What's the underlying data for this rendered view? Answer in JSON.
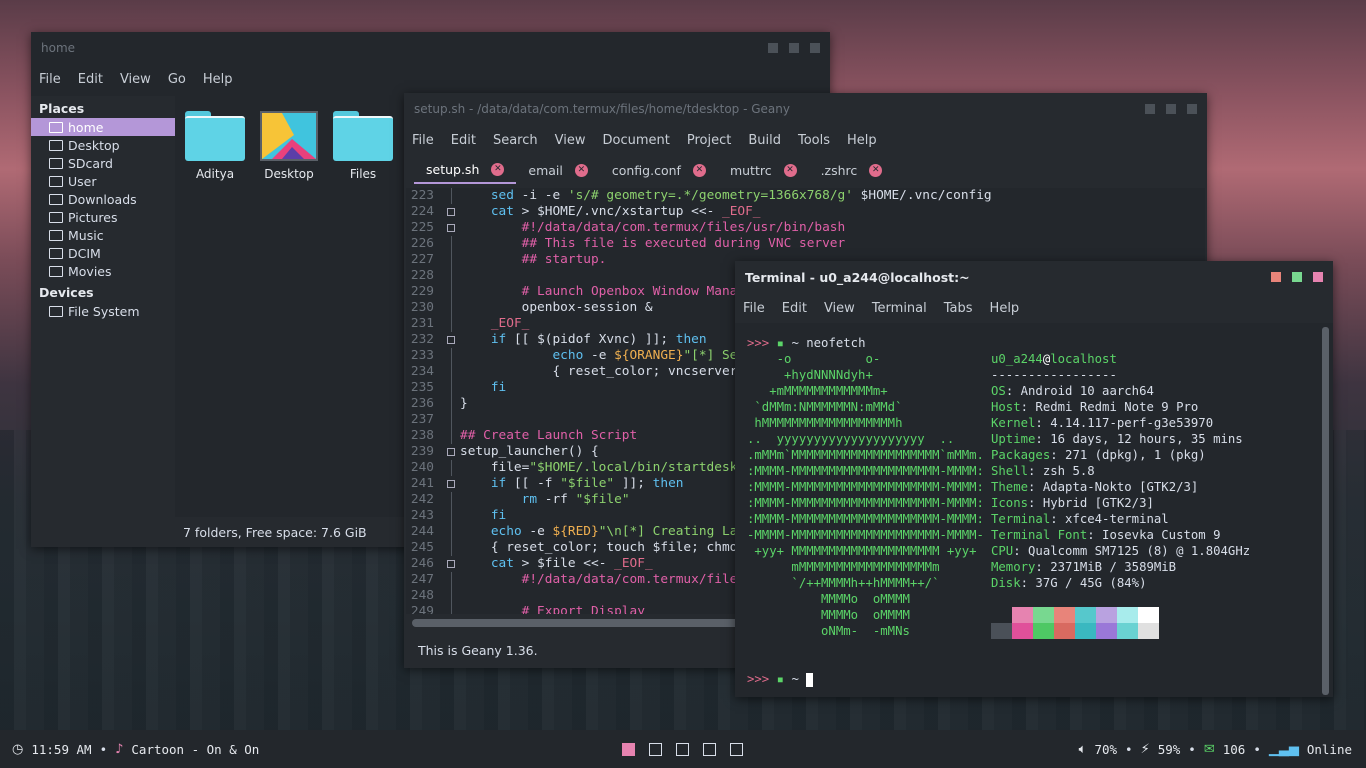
{
  "file_manager": {
    "title": "home",
    "menu": [
      "File",
      "Edit",
      "View",
      "Go",
      "Help"
    ],
    "places_header": "Places",
    "places": [
      "home",
      "Desktop",
      "SDcard",
      "User",
      "Downloads",
      "Pictures",
      "Music",
      "DCIM",
      "Movies"
    ],
    "devices_header": "Devices",
    "devices": [
      "File System"
    ],
    "items": [
      "Aditya",
      "Desktop",
      "Files"
    ],
    "status": "7 folders, Free space: 7.6 GiB"
  },
  "geany": {
    "title": "setup.sh - /data/data/com.termux/files/home/tdesktop - Geany",
    "menu": [
      "File",
      "Edit",
      "Search",
      "View",
      "Document",
      "Project",
      "Build",
      "Tools",
      "Help"
    ],
    "tabs": [
      "setup.sh",
      "email",
      "config.conf",
      "muttrc",
      ".zshrc"
    ],
    "line_numbers": [
      "223",
      "224",
      "225",
      "226",
      "227",
      "228",
      "229",
      "230",
      "231",
      "232",
      "233",
      "234",
      "235",
      "236",
      "237",
      "238",
      "239",
      "240",
      "241",
      "242",
      "243",
      "244",
      "245",
      "246",
      "247",
      "248",
      "249"
    ],
    "code": [
      "    sed -i -e 's/# geometry=.*/geometry=1366x768/g' $HOME/.vnc/config",
      "    cat > $HOME/.vnc/xstartup <<- _EOF_",
      "        #!/data/data/com.termux/files/usr/bin/bash",
      "        ## This file is executed during VNC server",
      "        ## startup.",
      "",
      "        # Launch Openbox Window Manager.",
      "        openbox-session &",
      "    _EOF_",
      "    if [[ $(pidof Xvnc) ]]; then",
      "            echo -e ${ORANGE}\"[*] Server Is Running...\"",
      "            { reset_color; vncserver -list; }",
      "    fi",
      "}",
      "",
      "## Create Launch Script",
      "setup_launcher() {",
      "    file=\"$HOME/.local/bin/startdesktop\"",
      "    if [[ -f \"$file\" ]]; then",
      "        rm -rf \"$file\"",
      "    fi",
      "    echo -e ${RED}\"\\n[*] Creating Launcher Script...\"",
      "    { reset_color; touch $file; chmod +x $file; }",
      "    cat > $file <<- _EOF_",
      "        #!/data/data/com.termux/files/usr/bin/bash",
      "",
      "        # Export Display"
    ],
    "status": "This is Geany 1.36."
  },
  "terminal": {
    "title": "Terminal - u0_a244@localhost:~",
    "menu": [
      "File",
      "Edit",
      "View",
      "Terminal",
      "Tabs",
      "Help"
    ],
    "prompt_arrows": ">>>",
    "prompt_dir": "~",
    "command": "neofetch",
    "ascii": [
      "    -o          o-",
      "     +hydNNNNdyh+",
      "   +mMMMMMMMMMMMMm+",
      " `dMMm:NMMMMMMN:mMMd`",
      " hMMMMMMMMMMMMMMMMMMh",
      "..  yyyyyyyyyyyyyyyyyyyy  ..",
      ".mMMm`MMMMMMMMMMMMMMMMMMMM`mMMm.",
      ":MMMM-MMMMMMMMMMMMMMMMMMMM-MMMM:",
      ":MMMM-MMMMMMMMMMMMMMMMMMMM-MMMM:",
      ":MMMM-MMMMMMMMMMMMMMMMMMMM-MMMM:",
      ":MMMM-MMMMMMMMMMMMMMMMMMMM-MMMM:",
      "-MMMM-MMMMMMMMMMMMMMMMMMMM-MMMM-",
      " +yy+ MMMMMMMMMMMMMMMMMMMM +yy+",
      "      mMMMMMMMMMMMMMMMMMMm",
      "      `/++MMMMh++hMMMM++/`",
      "          MMMMo  oMMMM",
      "          MMMMo  oMMMM",
      "          oNMm-  -mMNs"
    ],
    "user": "u0_a244",
    "host": "localhost",
    "separator": "-----------------",
    "info": [
      {
        "key": "OS",
        "value": "Android 10 aarch64"
      },
      {
        "key": "Host",
        "value": "Redmi Redmi Note 9 Pro"
      },
      {
        "key": "Kernel",
        "value": "4.14.117-perf-g3e53970"
      },
      {
        "key": "Uptime",
        "value": "16 days, 12 hours, 35 mins"
      },
      {
        "key": "Packages",
        "value": "271 (dpkg), 1 (pkg)"
      },
      {
        "key": "Shell",
        "value": "zsh 5.8"
      },
      {
        "key": "Theme",
        "value": "Adapta-Nokto [GTK2/3]"
      },
      {
        "key": "Icons",
        "value": "Hybrid [GTK2/3]"
      },
      {
        "key": "Terminal",
        "value": "xfce4-terminal"
      },
      {
        "key": "Terminal Font",
        "value": "Iosevka Custom 9"
      },
      {
        "key": "CPU",
        "value": "Qualcomm SM7125 (8) @ 1.804GHz"
      },
      {
        "key": "Memory",
        "value": "2371MiB / 3589MiB"
      },
      {
        "key": "Disk",
        "value": "37G / 45G (84%)"
      }
    ],
    "palette_top": [
      "#23272c",
      "#e683b0",
      "#78d890",
      "#e8847a",
      "#56c8cc",
      "#b9a2e0",
      "#a8ecec",
      "#ffffff"
    ],
    "palette_bottom": [
      "#4a5058",
      "#e0509a",
      "#4ec864",
      "#d86a60",
      "#3ab8c0",
      "#9a78d8",
      "#6ad2d2",
      "#e0e0e0"
    ],
    "window_button_colors": [
      "#e8847a",
      "#78d890",
      "#e683b0"
    ]
  },
  "taskbar": {
    "time": "11:59 AM",
    "song": "Cartoon - On & On",
    "volume": "70%",
    "battery": "59%",
    "mail": "106",
    "network": "Online",
    "workspaces": 5,
    "active_workspace": 1
  }
}
